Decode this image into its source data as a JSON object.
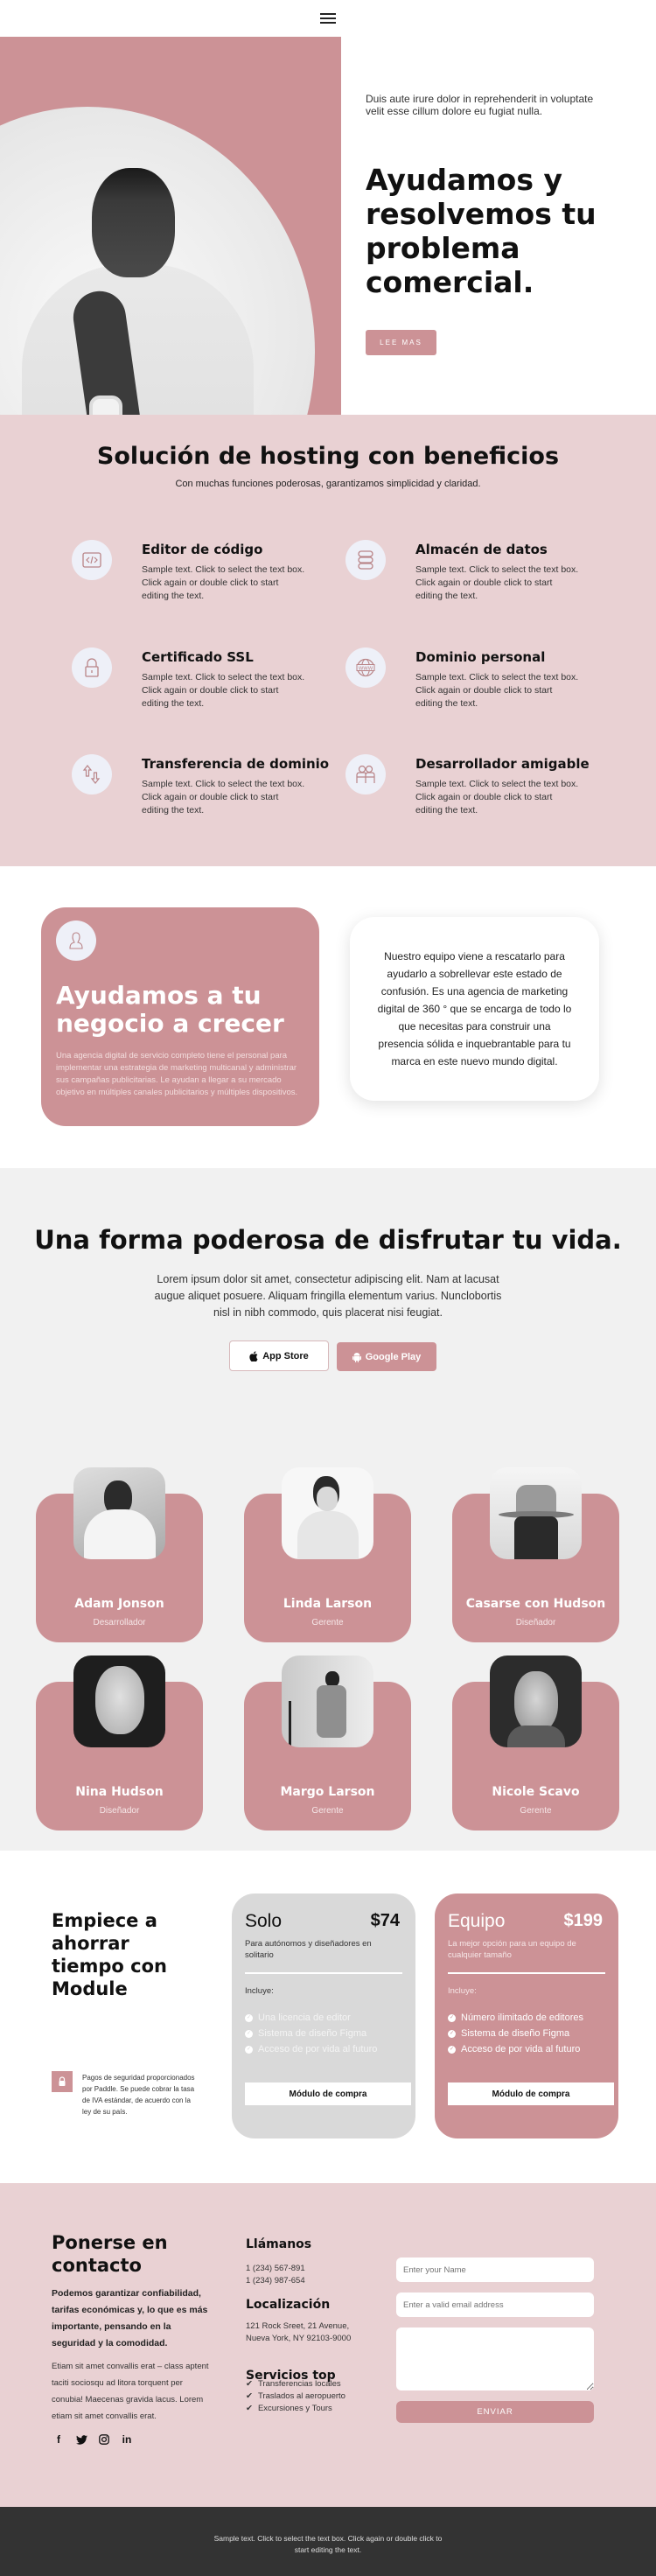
{
  "colors": {
    "accent": "#cc9296",
    "accent_light": "#e9d1d3",
    "icon_bg": "#eef0f8",
    "section_gray": "#f1f1f1",
    "footer_bg": "#333333"
  },
  "header": {
    "menu_icon": "hamburger-menu-icon"
  },
  "hero": {
    "subtitle": "Duis aute irure dolor in reprehenderit in voluptate velit esse cillum dolore eu fugiat nulla.",
    "title": "Ayudamos y resolvemos tu problema comercial.",
    "button_label": "LEE MAS"
  },
  "features": {
    "title": "Solución de hosting con beneficios",
    "subtitle": "Con muchas funciones poderosas, garantizamos simplicidad y claridad.",
    "items": [
      {
        "name": "Editor de código",
        "icon": "code-icon",
        "description": "Sample text. Click to select the text box. Click again or double click to start editing the text."
      },
      {
        "name": "Almacén de datos",
        "icon": "database-icon",
        "description": "Sample text. Click to select the text box. Click again or double click to start editing the text."
      },
      {
        "name": "Certificado SSL",
        "icon": "lock-icon",
        "description": "Sample text. Click to select the text box. Click again or double click to start editing the text."
      },
      {
        "name": "Dominio personal",
        "icon": "www-globe-icon",
        "description": "Sample text. Click to select the text box. Click again or double click to start editing the text."
      },
      {
        "name": "Transferencia de dominio",
        "icon": "transfer-arrows-icon",
        "description": "Sample text. Click to select the text box. Click again or double click to start editing the text."
      },
      {
        "name": "Desarrollador amigable",
        "icon": "people-icon",
        "description": "Sample text. Click to select the text box. Click again or double click to start editing the text."
      }
    ]
  },
  "grow": {
    "avatar_icon": "user-icon",
    "title": "Ayudamos a tu negocio a crecer",
    "text": "Una agencia digital de servicio completo tiene el personal para implementar una estrategia de marketing multicanal y administrar sus campañas publicitarias. Le ayudan a llegar a su mercado objetivo en múltiples canales publicitarios y múltiples dispositivos.",
    "quote": "Nuestro equipo viene a rescatarlo para ayudarlo a sobrellevar este estado de confusión. Es una agencia de marketing digital de 360 ° que se encarga de todo lo que necesitas para construir una presencia sólida e inquebrantable para tu marca en este nuevo mundo digital."
  },
  "app": {
    "title": "Una forma poderosa de disfrutar tu vida.",
    "text": "Lorem ipsum dolor sit amet, consectetur adipiscing elit. Nam at lacusat augue aliquet posuere. Aliquam fringilla elementum varius. Nunclobortis nisl in nibh commodo, quis placerat nisi feugiat.",
    "appstore_label": "App Store",
    "gplay_label": "Google Play"
  },
  "team": [
    {
      "name": "Adam Jonson",
      "role": "Desarrollador"
    },
    {
      "name": "Linda Larson",
      "role": "Gerente"
    },
    {
      "name": "Casarse con Hudson",
      "role": "Diseñador"
    },
    {
      "name": "Nina Hudson",
      "role": "Diseñador"
    },
    {
      "name": "Margo Larson",
      "role": "Gerente"
    },
    {
      "name": "Nicole Scavo",
      "role": "Gerente"
    }
  ],
  "pricing": {
    "title": "Empiece a ahorrar tiempo con Module",
    "secure_text": "Pagos de seguridad proporcionados por Paddle. Se puede cobrar la tasa de IVA estándar, de acuerdo con la ley de su país.",
    "plans": [
      {
        "name": "Solo",
        "price": "$74",
        "description": "Para autónomos y diseñadores en solitario",
        "includes_label": "Incluye:",
        "features": [
          "Una licencia de editor",
          "Sistema de diseño Figma",
          "Acceso de por vida al futuro"
        ],
        "button_label": "Módulo de compra"
      },
      {
        "name": "Equipo",
        "price": "$199",
        "description": "La mejor opción para un equipo de cualquier tamaño",
        "includes_label": "Incluye:",
        "features": [
          "Número ilimitado de editores",
          "Sistema de diseño Figma",
          "Acceso de por vida al futuro"
        ],
        "button_label": "Módulo de compra"
      }
    ]
  },
  "contact": {
    "title": "Ponerse en contacto",
    "lead": "Podemos garantizar confiabilidad, tarifas económicas y, lo que es más importante, pensando en la seguridad y la comodidad.",
    "text": "Etiam sit amet convallis erat – class aptent taciti sociosqu ad litora torquent per conubia! Maecenas gravida lacus. Lorem etiam sit amet convallis erat.",
    "socials": [
      "facebook-icon",
      "twitter-icon",
      "instagram-icon",
      "linkedin-icon"
    ],
    "call_title": "Llámanos",
    "phones": [
      "1 (234) 567-891",
      "1 (234) 987-654"
    ],
    "location_title": "Localización",
    "address": "121 Rock Sreet, 21 Avenue, Nueva York, NY 92103-9000",
    "services_title": "Servicios top",
    "services": [
      "Transferencias locales",
      "Traslados al aeropuerto",
      "Excursiones y Tours"
    ],
    "form": {
      "name_placeholder": "Enter your Name",
      "email_placeholder": "Enter a valid email address",
      "message_placeholder": "",
      "submit_label": "ENVIAR"
    }
  },
  "footer": {
    "text": "Sample text. Click to select the text box. Click again or double click to start editing the text."
  }
}
